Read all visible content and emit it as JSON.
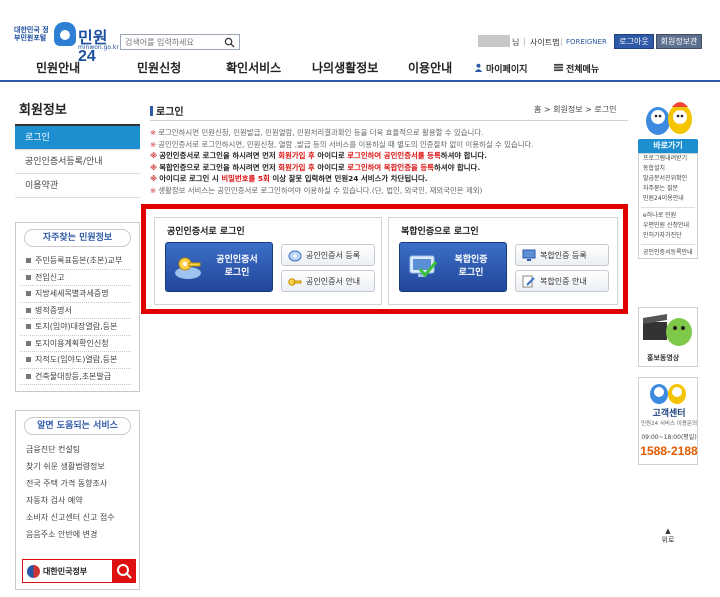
{
  "header": {
    "logo_small": "대한민국 정부민원포털",
    "logo_name": "민원24",
    "logo_url": "minwon.go.kr",
    "search_placeholder": "검색어를 입력하세요",
    "util_suffix": "님",
    "util_sitemap": "사이트맵",
    "util_foreigner": "FOREIGNER",
    "login_button": "로그아웃",
    "join_button": "회원정보관리"
  },
  "gnb": {
    "items": [
      "민원안내",
      "민원신청",
      "확인서비스",
      "나의생활정보",
      "이용안내"
    ],
    "mypage": "마이페이지",
    "all_menu": "전체메뉴"
  },
  "lnb": {
    "title": "회원정보",
    "items": [
      "로그인",
      "공인인증서등록/안내",
      "이용약관"
    ]
  },
  "frequent": {
    "title": "자주찾는 민원정보",
    "items": [
      "주민등록표등본(초본)교부",
      "전입신고",
      "지방세세목별과세증명",
      "병적증명서",
      "토지(임야)대장열람,등본",
      "토지이용계획확인신청",
      "지적도(임야도)열람,등본",
      "건축물대장등,초본발급"
    ]
  },
  "help": {
    "title": "알면 도움되는 서비스",
    "items": [
      "금융진단 컨설팅",
      "찾기 쉬운 생활법령정보",
      "전국 주택 가격 동향조사",
      "자동차 검사 예약",
      "소비자 신고센터 신고 접수",
      "음음주소 안반에 변경"
    ],
    "gov_label": "대한민국정부"
  },
  "main": {
    "title": "로그인",
    "breadcrumb": "홈 > 회원정보 > 로그인",
    "notices": [
      {
        "text": "로그인하시면 민원신청, 민원발급, 민원열람, 민원처리결과확인 등을 더욱 효율적으로 활용할 수 있습니다.",
        "bold": false
      },
      {
        "text": "공인인증서로 로그인하시면, 민원신청, 열람 ,발급 등의 서비스를 이용하실 때 별도의 인증절차 없이 이용하실 수 있습니다.",
        "bold": false
      },
      {
        "text_a": "공인인증서로 로그인을 하시려면 먼저 ",
        "red_a": "회원가입 후",
        "text_b": " 아이디로 ",
        "red_b": "로그인하여 공인인증서를 등록",
        "text_c": "하셔야 합니다.",
        "bold": true
      },
      {
        "text_a": "복합인증으로 로그인을 하시려면 먼저 ",
        "red_a": "회원가입 후",
        "text_b": " 아이디로 ",
        "red_b": "로그인하여 복합인증을 등록",
        "text_c": "하셔야 합니다.",
        "bold": true
      },
      {
        "text_a": "아이디로 로그인 시 ",
        "red_a": "비밀번호를 5회",
        "text_b": " 이상 잘못 입력하면 민원24 서비스가 차단됩니다.",
        "bold": true
      },
      {
        "text": "생활정보 서비스는 공인인증서로 로그인하여야 이용하실 수 있습니다.(단, 법인, 외국인, 재외국민은 제외)",
        "bold": false
      }
    ],
    "cert_panel": {
      "title": "공인인증서로 로그인",
      "big_button": "공인인증서\n로그인",
      "register": "공인인증서 등록",
      "guide": "공인인증서 안내"
    },
    "multi_panel": {
      "title": "복합인증으로 로그인",
      "big_button": "복합인증\n로그인",
      "register": "복합인증 등록",
      "guide": "복합인증 안내"
    }
  },
  "quick": {
    "title": "바로가기",
    "items": [
      "프로그램내려받기",
      "동합설치",
      "발급문서진위확인",
      "자주묻는 질문",
      "민원24이용안내",
      "e하나로 민원",
      "우편민원 신청안내",
      "인허가자가진단",
      "공인인증서등록안내"
    ],
    "promo": "홍보동영상",
    "call_title": "고객센터",
    "call_sub": "민원24 서비스 이용문의",
    "call_hours": "09:00~18:00(평일)",
    "call_number": "1588-2188",
    "top": "위로"
  },
  "colors": {
    "accent": "#2f5aa7",
    "active_tab": "#1d8fd1",
    "highlight_border": "#e00000",
    "notice_red": "#d11111",
    "call_number": "#e25a00"
  }
}
